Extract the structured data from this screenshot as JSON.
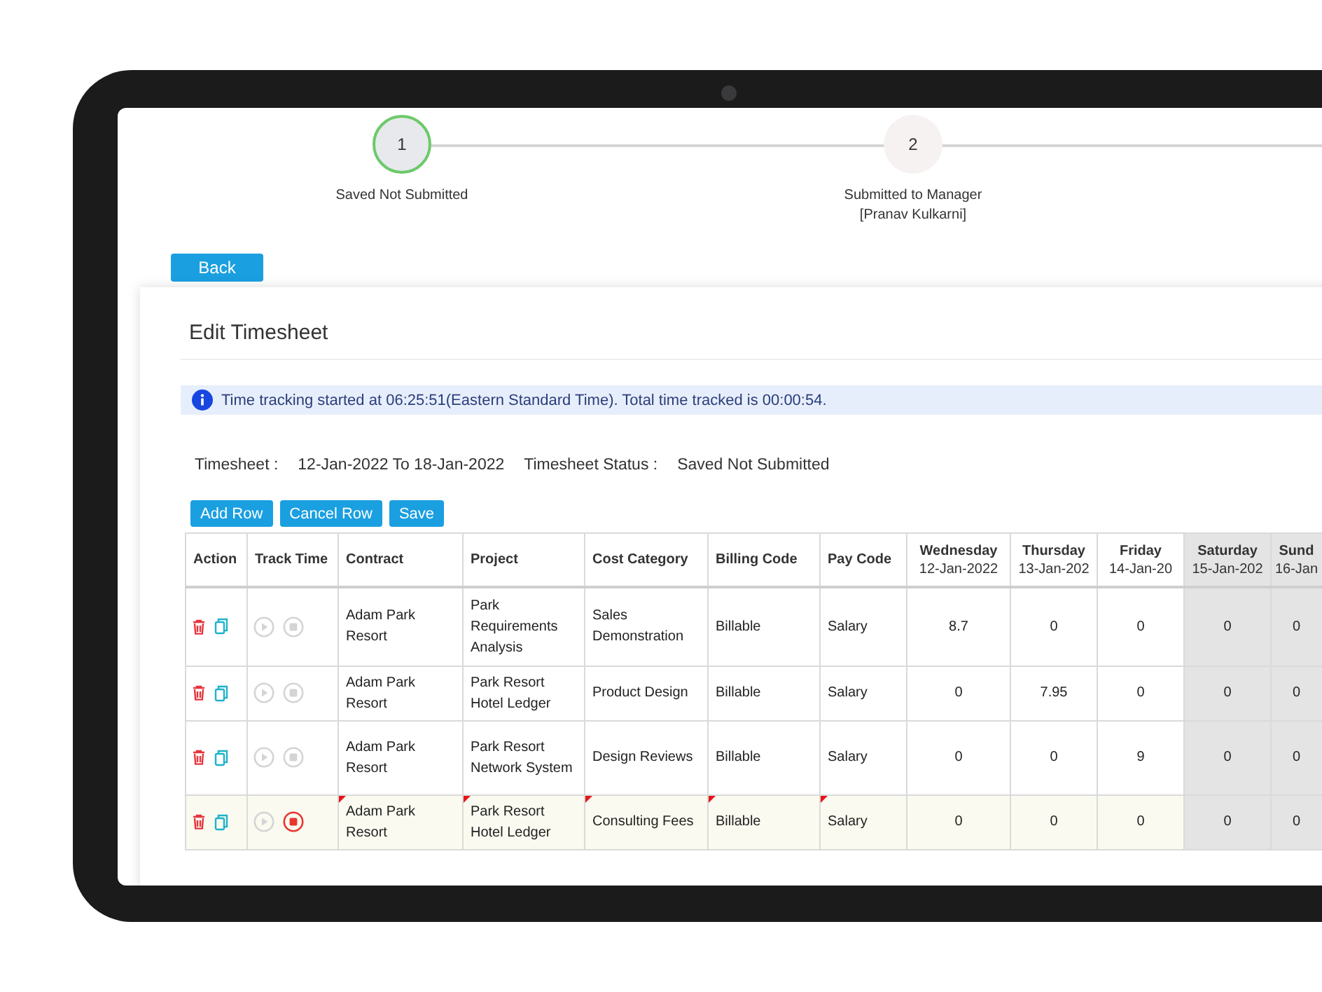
{
  "stepper": {
    "steps": [
      {
        "number": "1",
        "label": "Saved Not Submitted",
        "current": true
      },
      {
        "number": "2",
        "label": "Submitted to Manager",
        "sublabel": "[Pranav Kulkarni]",
        "current": false
      }
    ]
  },
  "back_button": "Back",
  "card": {
    "title": "Edit Timesheet",
    "banner": "Time tracking started at 06:25:51(Eastern Standard Time). Total time tracked is 00:00:54.",
    "meta": [
      {
        "label": "Timesheet :",
        "value": "12-Jan-2022 To 18-Jan-2022"
      },
      {
        "label": "Timesheet Status :",
        "value": "Saved Not Submitted"
      }
    ],
    "buttons": [
      "Add Row",
      "Cancel Row",
      "Save"
    ],
    "table": {
      "columns": [
        {
          "label": "Action"
        },
        {
          "label": "Track Time"
        },
        {
          "label": "Contract"
        },
        {
          "label": "Project"
        },
        {
          "label": "Cost Category"
        },
        {
          "label": "Billing Code"
        },
        {
          "label": "Pay Code"
        },
        {
          "label": "Wednesday",
          "date": "12-Jan-2022",
          "weekend": false
        },
        {
          "label": "Thursday",
          "date": "13-Jan-202",
          "weekend": false
        },
        {
          "label": "Friday",
          "date": "14-Jan-20",
          "weekend": false
        },
        {
          "label": "Saturday",
          "date": "15-Jan-202",
          "weekend": true
        },
        {
          "label": "Sund",
          "date": "16-Jan",
          "weekend": true
        }
      ],
      "rows": [
        {
          "tracking": false,
          "modified": false,
          "contract": "Adam Park Resort",
          "project": "Park Requirements Analysis",
          "cost_category": "Sales Demonstration",
          "billing_code": "Billable",
          "pay_code": "Salary",
          "hours": [
            "8.7",
            "0",
            "0",
            "0",
            "0"
          ]
        },
        {
          "tracking": false,
          "modified": false,
          "contract": "Adam Park Resort",
          "project": "Park Resort Hotel Ledger",
          "cost_category": "Product Design",
          "billing_code": "Billable",
          "pay_code": "Salary",
          "hours": [
            "0",
            "7.95",
            "0",
            "0",
            "0"
          ]
        },
        {
          "tracking": false,
          "modified": false,
          "contract": "Adam Park Resort",
          "project": "Park Resort Network System",
          "cost_category": "Design Reviews",
          "billing_code": "Billable",
          "pay_code": "Salary",
          "hours": [
            "0",
            "0",
            "9",
            "0",
            "0"
          ]
        },
        {
          "tracking": true,
          "modified": true,
          "contract": "Adam Park Resort",
          "project": "Park Resort Hotel Ledger",
          "cost_category": "Consulting Fees",
          "billing_code": "Billable",
          "pay_code": "Salary",
          "hours": [
            "0",
            "0",
            "0",
            "0",
            "0"
          ]
        }
      ]
    }
  }
}
